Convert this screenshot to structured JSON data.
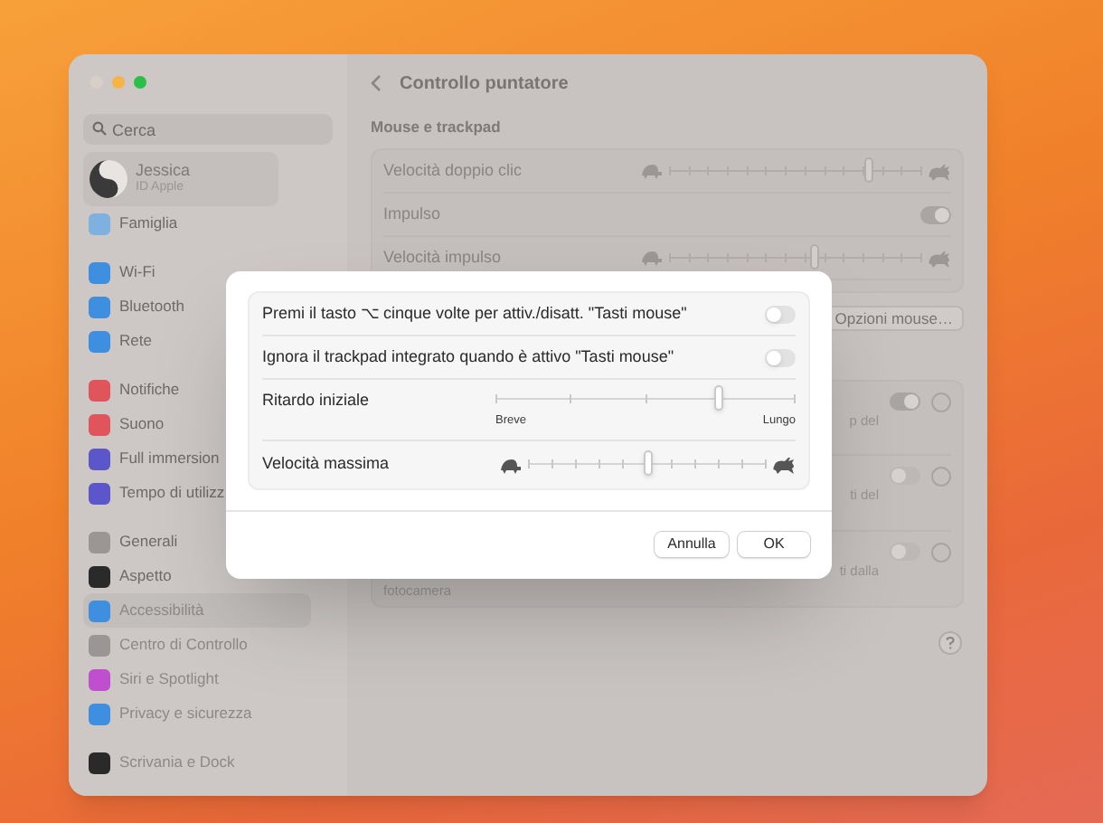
{
  "window": {
    "controls": [
      {
        "color": "#d9cfc9"
      },
      {
        "color": "#f5b445"
      },
      {
        "color": "#2bbf4a"
      }
    ]
  },
  "sidebar": {
    "search": {
      "placeholder": "Cerca"
    },
    "profile": {
      "name": "Jessica",
      "subtitle": "ID Apple"
    },
    "groups": [
      {
        "items": [
          {
            "label": "Famiglia",
            "color": "#7fb1e0",
            "selected": false,
            "faded": false
          }
        ]
      },
      {
        "items": [
          {
            "label": "Wi-Fi",
            "color": "#3f8fe0",
            "selected": false,
            "faded": false
          },
          {
            "label": "Bluetooth",
            "color": "#3f8fe0",
            "selected": false,
            "faded": false
          },
          {
            "label": "Rete",
            "color": "#3f8fe0",
            "selected": false,
            "faded": false
          }
        ]
      },
      {
        "items": [
          {
            "label": "Notifiche",
            "color": "#e0545c",
            "selected": false,
            "faded": false
          },
          {
            "label": "Suono",
            "color": "#e0545c",
            "selected": false,
            "faded": false
          },
          {
            "label": "Full immersion",
            "color": "#5b56c9",
            "selected": false,
            "faded": false
          },
          {
            "label": "Tempo di utilizz",
            "color": "#5b56c9",
            "selected": false,
            "faded": false
          }
        ]
      },
      {
        "items": [
          {
            "label": "Generali",
            "color": "#9a9696",
            "selected": false,
            "faded": false
          },
          {
            "label": "Aspetto",
            "color": "#2a2a2a",
            "selected": false,
            "faded": false
          },
          {
            "label": "Accessibilità",
            "color": "#3f8fe0",
            "selected": true,
            "faded": true
          },
          {
            "label": "Centro di Controllo",
            "color": "#9a9696",
            "selected": false,
            "faded": true
          },
          {
            "label": "Siri e Spotlight",
            "color": "#c04fd0",
            "selected": false,
            "faded": true
          },
          {
            "label": "Privacy e sicurezza",
            "color": "#3f8fe0",
            "selected": false,
            "faded": true
          }
        ]
      },
      {
        "items": [
          {
            "label": "Scrivania e Dock",
            "color": "#2a2a2a",
            "selected": false,
            "faded": true
          }
        ]
      }
    ]
  },
  "main": {
    "title": "Controllo puntatore",
    "section": "Mouse e trackpad",
    "rows": [
      {
        "kind": "slider",
        "label": "Velocità doppio clic",
        "level": 0.8
      },
      {
        "kind": "toggle",
        "label": "Impulso",
        "on": true
      },
      {
        "kind": "slider",
        "label": "Velocità impulso",
        "level": 0.58
      }
    ],
    "options_button": "Opzioni mouse…",
    "options": [
      {
        "text": "p del",
        "on": true
      },
      {
        "text": "ti del",
        "on": false
      },
      {
        "text": "ti dalla",
        "on": false
      }
    ],
    "footnote": "fotocamera"
  },
  "dialog": {
    "rows": [
      {
        "kind": "toggle",
        "label": "Premi il tasto ⌥ cinque volte per attiv./disatt. \"Tasti mouse\"",
        "on": false
      },
      {
        "kind": "toggle",
        "label": "Ignora il trackpad integrato quando è attivo \"Tasti mouse\"",
        "on": false
      },
      {
        "kind": "range",
        "label": "Ritardo iniziale",
        "level": 0.75,
        "min_label": "Breve",
        "max_label": "Lungo"
      },
      {
        "kind": "speed",
        "label": "Velocità massima",
        "level": 0.5
      }
    ],
    "buttons": [
      {
        "label": "Annulla",
        "default": false
      },
      {
        "label": "OK",
        "default": false
      }
    ]
  }
}
